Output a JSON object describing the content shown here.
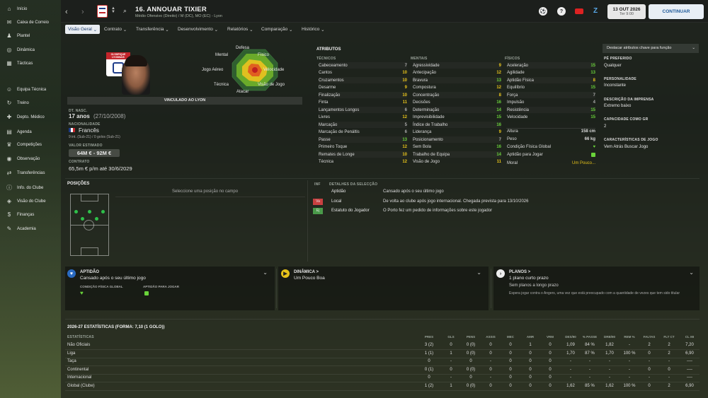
{
  "sidebar": {
    "items": [
      {
        "icon": "home-icon",
        "label": "Início"
      },
      {
        "icon": "inbox-icon",
        "label": "Caixa de Correio"
      },
      {
        "icon": "squad-icon",
        "label": "Plantel"
      },
      {
        "icon": "dynamics-icon",
        "label": "Dinâmica"
      },
      {
        "icon": "tactics-icon",
        "label": "Tácticas"
      },
      {
        "icon": "staff-icon",
        "label": "Equipa Técnica"
      },
      {
        "icon": "training-icon",
        "label": "Treino"
      },
      {
        "icon": "medical-icon",
        "label": "Depto. Médico"
      },
      {
        "icon": "calendar-icon",
        "label": "Agenda"
      },
      {
        "icon": "trophy-icon",
        "label": "Competições"
      },
      {
        "icon": "scouting-icon",
        "label": "Observação"
      },
      {
        "icon": "transfer-icon",
        "label": "Transferências"
      },
      {
        "icon": "club-info-icon",
        "label": "Info. do Clube"
      },
      {
        "icon": "club-vision-icon",
        "label": "Visão do Clube"
      },
      {
        "icon": "finance-icon",
        "label": "Finanças"
      },
      {
        "icon": "academy-icon",
        "label": "Academia"
      }
    ]
  },
  "header": {
    "player_title": "16. ANNOUAR TIXIER",
    "player_subtitle": "Médio Ofensivo (Direito) / M (DC), MO (EC) - Lyon",
    "date_main": "13 OUT 2026",
    "date_sub": "Ter 9:00",
    "continue_label": "CONTINUAR"
  },
  "tabs": [
    {
      "label": "Visão Geral"
    },
    {
      "label": "Contrato"
    },
    {
      "label": "Transferência"
    },
    {
      "label": "Desenvolvimento"
    },
    {
      "label": "Relatórios"
    },
    {
      "label": "Comparação"
    },
    {
      "label": "Histórico"
    }
  ],
  "profile": {
    "club_badge_text": "OLYMPIQUE LYONNAIS",
    "radar_labels": [
      "Defesa",
      "Físico",
      "Velocidade",
      "Visão de Jogo",
      "Atacar",
      "Técnica",
      "Jogo Aéreo",
      "Mental"
    ],
    "contract_banner": "VINCULADO AO LYON",
    "dob_label": "DT. NASC.",
    "age": "17 anos",
    "dob": "(27/10/2008)",
    "nationality_label": "NACIONALIDADE",
    "nationality": "Francês",
    "caps": "9 int. (Sub-21) / 0 golos (Sub-21)",
    "value_label": "VALOR ESTIMADO",
    "value": "64M € - 92M €",
    "contract_label": "CONTRATO",
    "contract": "65,5m € p/m até 30/6/2029"
  },
  "attributes": {
    "title": "ATRIBUTOS",
    "technical_label": "TÉCNICOS",
    "mental_label": "MENTAIS",
    "physical_label": "FÍSICOS",
    "technical": [
      [
        "Cabeceamento",
        "7"
      ],
      [
        "Cantos",
        "10"
      ],
      [
        "Cruzamentos",
        "10"
      ],
      [
        "Desarme",
        "9"
      ],
      [
        "Finalização",
        "10"
      ],
      [
        "Finta",
        "11"
      ],
      [
        "Lançamentos Longos",
        "6"
      ],
      [
        "Livres",
        "12"
      ],
      [
        "Marcação",
        "5"
      ],
      [
        "Marcação de Penáltis",
        "6"
      ],
      [
        "Passe",
        "13"
      ],
      [
        "Primeiro Toque",
        "12"
      ],
      [
        "Remates de Longe",
        "10"
      ],
      [
        "Técnica",
        "12"
      ]
    ],
    "mental": [
      [
        "Agressividade",
        "9"
      ],
      [
        "Antecipação",
        "12"
      ],
      [
        "Bravura",
        "13"
      ],
      [
        "Compostura",
        "12"
      ],
      [
        "Concentração",
        "8"
      ],
      [
        "Decisões",
        "16"
      ],
      [
        "Determinação",
        "14"
      ],
      [
        "Imprevisibilidade",
        "15"
      ],
      [
        "Índice de Trabalho",
        "16"
      ],
      [
        "Liderança",
        "9"
      ],
      [
        "Posicionamento",
        "7"
      ],
      [
        "Sem Bola",
        "16"
      ],
      [
        "Trabalho de Equipa",
        "14"
      ],
      [
        "Visão de Jogo",
        "11"
      ]
    ],
    "physical": [
      [
        "Aceleração",
        "15"
      ],
      [
        "Agilidade",
        "13"
      ],
      [
        "Aptidão Física",
        "8"
      ],
      [
        "Equilíbrio",
        "15"
      ],
      [
        "Força",
        "7"
      ],
      [
        "Impulsão",
        "4"
      ],
      [
        "Resistência",
        "15"
      ],
      [
        "Velocidade",
        "15"
      ]
    ],
    "height_label": "Altura",
    "height": "158 cm",
    "weight_label": "Peso",
    "weight": "66 kg",
    "condition_label": "Condição Física Global",
    "fit_label": "Aptidão para Jogar",
    "morale_label": "Moral",
    "morale": "Um Pouco..."
  },
  "right_panel": {
    "highlight_select": "Destacar atributos chave para função",
    "preferred_foot_label": "PÉ PREFERIDO",
    "preferred_foot": "Qualquer",
    "personality_label": "PERSONALIDADE",
    "personality": "Inconstante",
    "press_label": "DESCRIÇÃO DA IMPRENSA",
    "press": "Extremo baixo",
    "captaincy_label": "CAPACIDADE COMO GR",
    "captaincy": "2",
    "traits_label": "CARACTERÍSTICAS DE JOGO",
    "traits": "Vem Atrás Buscar Jogo"
  },
  "positions": {
    "title": "POSIÇÕES",
    "hint": "Seleccione uma posição no campo"
  },
  "info": {
    "title": "INF",
    "details_title": "DETALHES DA SELECÇÃO",
    "rows": [
      {
        "badge": "",
        "label": "Aptidão",
        "text": "Cansado após o seu último jogo"
      },
      {
        "badge": "Va",
        "label": "Local",
        "text": "De volta ao clube após jogo internacional. Chegada prevista para 13/10/2026"
      },
      {
        "badge": "Ej",
        "label": "Estatuto do Jogador",
        "text": "O Porto fez um pedido de informações sobre este jogador"
      }
    ]
  },
  "cards": {
    "fitness": {
      "title": "APTIDÃO",
      "text": "Cansado após o seu último jogo",
      "sub1": "CONDIÇÃO FÍSICA GLOBAL",
      "sub2": "APTIDÃO PARA JOGAR"
    },
    "dynamics": {
      "title": "DINÂMICA >",
      "text": "Um Pouco Boa"
    },
    "plans": {
      "title": "PLANOS >",
      "text": "1 plano curto prazo",
      "sub": "Sem planos a longo prazo",
      "detail": "Espera jogar contra o Angers, uma vez que está preocupado com a quantidade de vezes que tem sido titular"
    }
  },
  "stats": {
    "title": "2026-27 ESTATÍSTICAS (FORMA: 7,10 (1 GOLO))",
    "row_header": "ESTATÍSTICAS",
    "columns": [
      "PRES",
      "GLS",
      "PENS",
      "ASSIS",
      "MEC",
      "AMR",
      "VRM",
      "DES/90",
      "% PASSE",
      "DRB/90",
      "REM %",
      "FALTAS",
      "FLT CT",
      "CL MI"
    ],
    "rows": [
      {
        "label": "Não Oficiais",
        "values": [
          "3 (2)",
          "0",
          "0 (0)",
          "0",
          "0",
          "1",
          "0",
          "1,09",
          "84 %",
          "1,82",
          "-",
          "2",
          "2",
          "7,20"
        ]
      },
      {
        "label": "Liga",
        "values": [
          "1 (1)",
          "1",
          "0 (0)",
          "0",
          "0",
          "0",
          "0",
          "1,70",
          "87 %",
          "1,70",
          "100 %",
          "0",
          "2",
          "6,90"
        ]
      },
      {
        "label": "Taça",
        "values": [
          "0",
          "-",
          "0",
          "-",
          "0",
          "0",
          "0",
          "-",
          "-",
          "-",
          "-",
          "-",
          "-",
          "----"
        ]
      },
      {
        "label": "Continental",
        "values": [
          "0 (1)",
          "0",
          "0 (0)",
          "0",
          "0",
          "0",
          "0",
          "-",
          "-",
          "-",
          "-",
          "0",
          "0",
          "----"
        ]
      },
      {
        "label": "Internacional",
        "values": [
          "0",
          "-",
          "0",
          "-",
          "0",
          "0",
          "0",
          "-",
          "-",
          "-",
          "-",
          "-",
          "-",
          "----"
        ]
      },
      {
        "label": "Global (Clube)",
        "values": [
          "1 (2)",
          "1",
          "0 (0)",
          "0",
          "0",
          "0",
          "0",
          "1,62",
          "85 %",
          "1,62",
          "100 %",
          "0",
          "2",
          "6,90"
        ]
      }
    ]
  },
  "colors": {
    "accent": "#2a7bd6",
    "good": "#6ad33a",
    "mid": "#e6c21a",
    "low": "#e04a3a"
  }
}
